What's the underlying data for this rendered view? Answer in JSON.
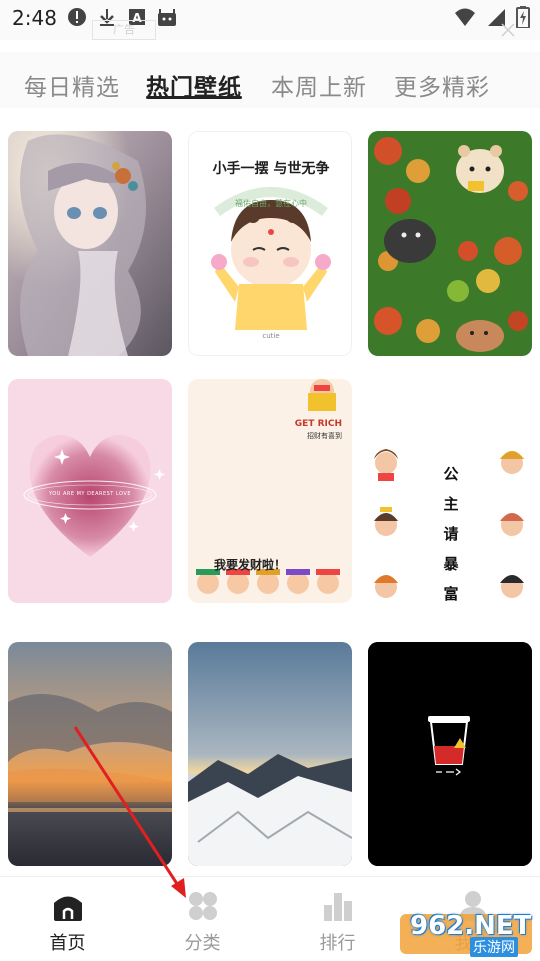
{
  "status_bar": {
    "time": "2:48",
    "ad_label": "广告",
    "icons": [
      "alert-icon",
      "download-icon",
      "a-icon",
      "android-icon",
      "wifi-icon",
      "signal-icon",
      "battery-charging-icon"
    ]
  },
  "tabs": [
    {
      "label": "每日精选",
      "active": false
    },
    {
      "label": "热门壁纸",
      "active": true
    },
    {
      "label": "本周上新",
      "active": false
    },
    {
      "label": "更多精彩",
      "active": false
    }
  ],
  "wallpapers": {
    "anime_girl": {
      "alt": ""
    },
    "buddha": {
      "title": "小手一摆 与世无争",
      "arc_text": "福佑自由，慧在心中",
      "small": "cutie"
    },
    "hamster": {
      "alt": ""
    },
    "heart": {
      "text": "YOU ARE MY DEAREST LOVE"
    },
    "rich": {
      "title": "GET RICH",
      "subtitle": "招财有喜到",
      "bottom_text": "我要发财啦！"
    },
    "princess": {
      "chars": [
        "公",
        "主",
        "请",
        "暴",
        "富"
      ]
    },
    "sunset": {
      "alt": ""
    },
    "mountains": {
      "alt": ""
    },
    "coffee": {
      "alt": ""
    }
  },
  "bottom_nav": [
    {
      "label": "首页",
      "icon": "home-icon",
      "active": true
    },
    {
      "label": "分类",
      "icon": "category-icon",
      "active": false
    },
    {
      "label": "排行",
      "icon": "ranking-icon",
      "active": false
    },
    {
      "label": "我的",
      "icon": "profile-icon",
      "active": false
    }
  ],
  "watermark": {
    "main": "962.NET",
    "sub": "乐游网"
  },
  "colors": {
    "accent": "#222222",
    "inactive": "#9a9a9a",
    "arrow": "#e02020"
  }
}
